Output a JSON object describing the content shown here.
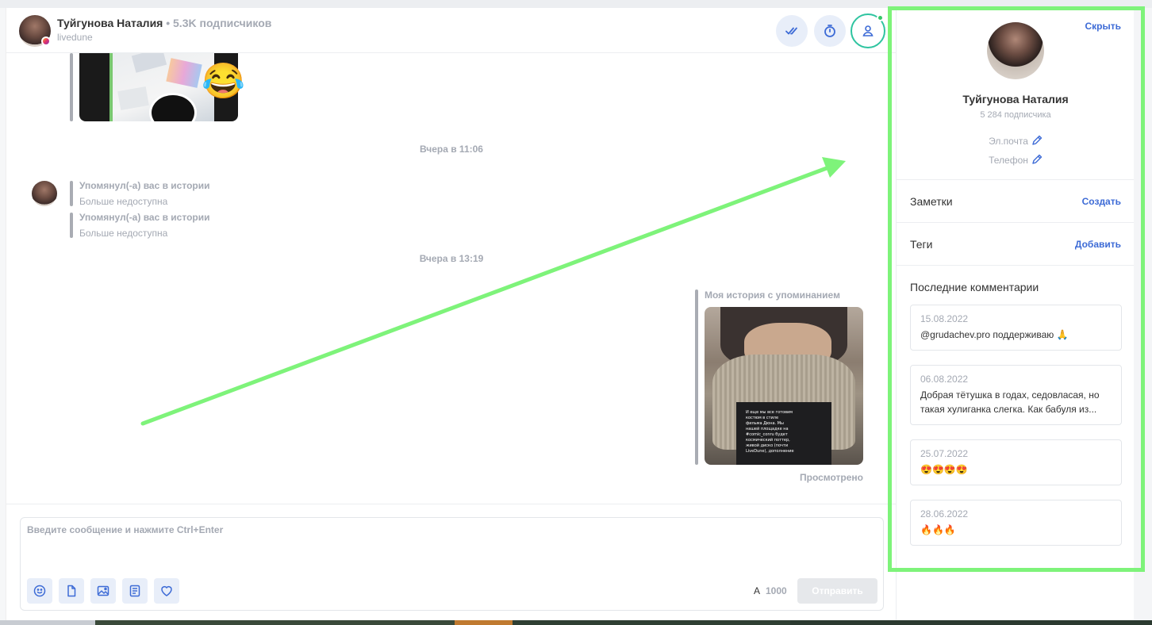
{
  "header": {
    "name": "Туйгунова Наталия",
    "subscribers": "• 5.3K подписчиков",
    "handle": "livedune"
  },
  "messages": {
    "date_1": "Вчера в 11:06",
    "mention_1_title": "Упомянул(-а) вас в истории",
    "mention_1_sub": "Больше недоступна",
    "mention_2_title": "Упомянул(-а) вас в истории",
    "mention_2_sub": "Больше недоступна",
    "date_2": "Вчера в 13:19",
    "my_story_title": "Моя история с упоминанием",
    "story_text": "И еще мы все готовим костюм в стиле фильма Дюна. Мы нашей площадке на #comic_conru будет космический поттер, живой диско (почти LiveDune), дополнение",
    "viewed": "Просмотрено",
    "laugh_emoji": "😂"
  },
  "composer": {
    "placeholder": "Введите сообщение и нажмите Ctrl+Enter",
    "char_a": "A",
    "char_count": "1000",
    "send_label": "Отправить"
  },
  "profile": {
    "hide_label": "Скрыть",
    "name": "Туйгунова Наталия",
    "subscribers": "5 284 подписчика",
    "email_label": "Эл.почта",
    "phone_label": "Телефон",
    "notes_title": "Заметки",
    "notes_action": "Создать",
    "tags_title": "Теги",
    "tags_action": "Добавить",
    "comments_title": "Последние комментарии",
    "comments": [
      {
        "date": "15.08.2022",
        "text": "@grudachev.pro поддерживаю 🙏"
      },
      {
        "date": "06.08.2022",
        "text": "Добрая тётушка в годах, седовласая, но такая хулиганка слегка. Как бабуля из..."
      },
      {
        "date": "25.07.2022",
        "text": "😍😍😍😍"
      },
      {
        "date": "28.06.2022",
        "text": "🔥🔥🔥"
      }
    ]
  },
  "colors": {
    "accent": "#3d6bd6",
    "highlight": "#7ef37a",
    "online": "#35c76a",
    "muted": "#a4a9b3"
  }
}
